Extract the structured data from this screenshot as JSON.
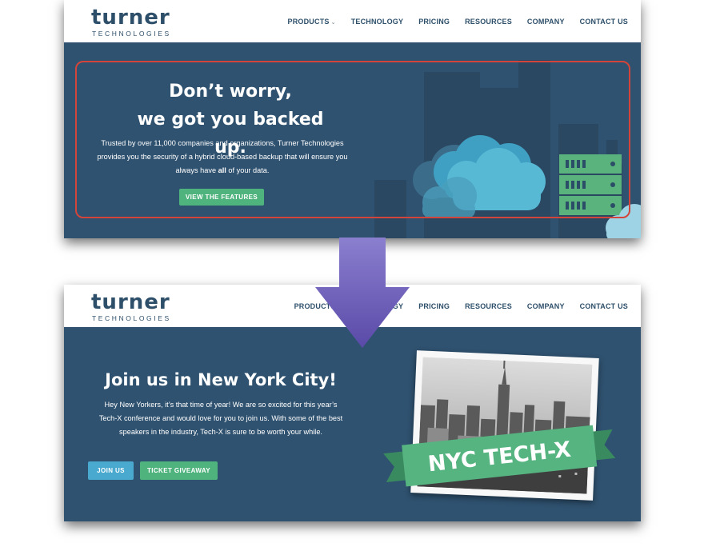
{
  "before": {
    "logo": {
      "main": "turner",
      "sub": "TECHNOLOGIES"
    },
    "nav": [
      {
        "label": "PRODUCTS",
        "dropdown": true
      },
      {
        "label": "TECHNOLOGY"
      },
      {
        "label": "PRICING"
      },
      {
        "label": "RESOURCES"
      },
      {
        "label": "COMPANY"
      },
      {
        "label": "CONTACT US"
      }
    ],
    "hero": {
      "title_line1": "Don’t worry,",
      "title_line2": "we got you backed up.",
      "para_line1": "Trusted by over 11,000 companies and organizations, Turner Technologies",
      "para_line2": "provides you the security of a hybrid cloud-based backup that will ensure you",
      "para_line3_before": "always have ",
      "para_line3_bold": "all",
      "para_line3_after": " of your data.",
      "cta": "VIEW THE FEATURES"
    }
  },
  "after": {
    "logo": {
      "main": "turner",
      "sub": "TECHNOLOGIES"
    },
    "nav": [
      {
        "label": "PRODUCTS"
      },
      {
        "label": "TECHNOLOGY"
      },
      {
        "label": "PRICING"
      },
      {
        "label": "RESOURCES"
      },
      {
        "label": "COMPANY"
      },
      {
        "label": "CONTACT US"
      }
    ],
    "hero": {
      "title": "Join us in New York City!",
      "para_line1": "Hey New Yorkers, it’s that time of year! We are so excited for this year’s",
      "para_line2": "Tech-X conference and would love for you to join us. With some of the best",
      "para_line3": "speakers in the industry, Tech-X is sure to be worth your while.",
      "button1": "JOIN US",
      "button2": "TICKET GIVEAWAY",
      "banner": "NYC TECH-X"
    }
  },
  "colors": {
    "navy": "#2f5270",
    "green": "#4fb37e",
    "blue": "#4aa9cf",
    "highlight_red": "#d3453a",
    "arrow_purple": "#5e4fae"
  }
}
